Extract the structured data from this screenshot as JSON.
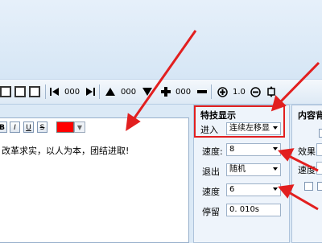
{
  "toolbar": {
    "counter_a": "000",
    "counter_b": "000",
    "counter_c": "000",
    "zoom_value": "1.0"
  },
  "editor": {
    "text": "改革求实，以人为本，团结进取!",
    "text_color": "#ff0000",
    "format_buttons": [
      "B",
      "I",
      "U",
      "S"
    ]
  },
  "effects": {
    "title": "特技显示",
    "enter_label": "进入",
    "enter_value": "连续左移显",
    "speed_label": "速度:",
    "speed_in_value": "8",
    "exit_label": "退出",
    "exit_value": "随机",
    "speed2_label": "速度",
    "speed_out_value": "6",
    "stay_label": "停留",
    "stay_value": "0. 010s"
  },
  "content_panel": {
    "title": "内容背",
    "effect_label": "效果",
    "speed_label": "速度"
  },
  "colors": {
    "annotation_red": "#e21f1f",
    "highlight_box": "#e21f1f"
  }
}
